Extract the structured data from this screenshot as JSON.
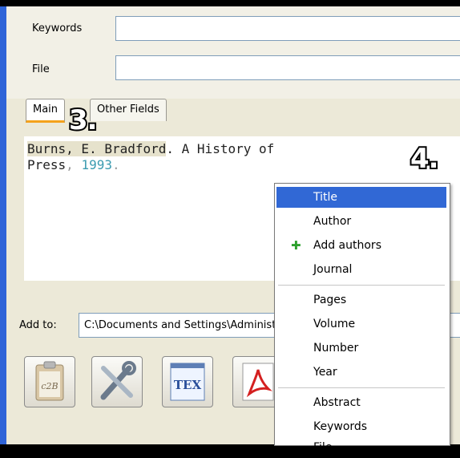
{
  "fields": {
    "keywords_label": "Keywords",
    "keywords_value": "",
    "file_label": "File",
    "file_value": ""
  },
  "tabs": [
    {
      "label": "Main",
      "active": true
    },
    {
      "label": "Other Fields",
      "active": false
    }
  ],
  "source": {
    "line1_author": "Burns, E. Bradford",
    "line1_title": ". A History of",
    "line2_publisher": "Press",
    "line2_comma": ", ",
    "line2_year": "1993",
    "line2_end": "."
  },
  "add_to": {
    "label": "Add to:",
    "path": "C:\\Documents and Settings\\Administrator\\My Documents\\bib"
  },
  "toolbar": {
    "buttons": [
      {
        "name": "clipboard-c2b",
        "text": "c2B"
      },
      {
        "name": "tools",
        "text": ""
      },
      {
        "name": "tex",
        "text": "TEX"
      },
      {
        "name": "pdf",
        "text": ""
      }
    ]
  },
  "context_menu": {
    "items_group1": [
      {
        "label": "Title",
        "selected": true,
        "icon": ""
      },
      {
        "label": "Author",
        "selected": false,
        "icon": ""
      },
      {
        "label": "Add authors",
        "selected": false,
        "icon": "green-plus-icon"
      },
      {
        "label": "Journal",
        "selected": false,
        "icon": ""
      }
    ],
    "items_group2": [
      "Pages",
      "Volume",
      "Number",
      "Year"
    ],
    "items_group3": [
      "Abstract",
      "Keywords",
      "File"
    ]
  },
  "annotations": {
    "step3": "3.",
    "step4": "4."
  },
  "colors": {
    "selection": "#3168d5",
    "tab_accent": "#f4a21c",
    "year_text": "#3a9bb0",
    "window_frame": "#2f64d8"
  }
}
